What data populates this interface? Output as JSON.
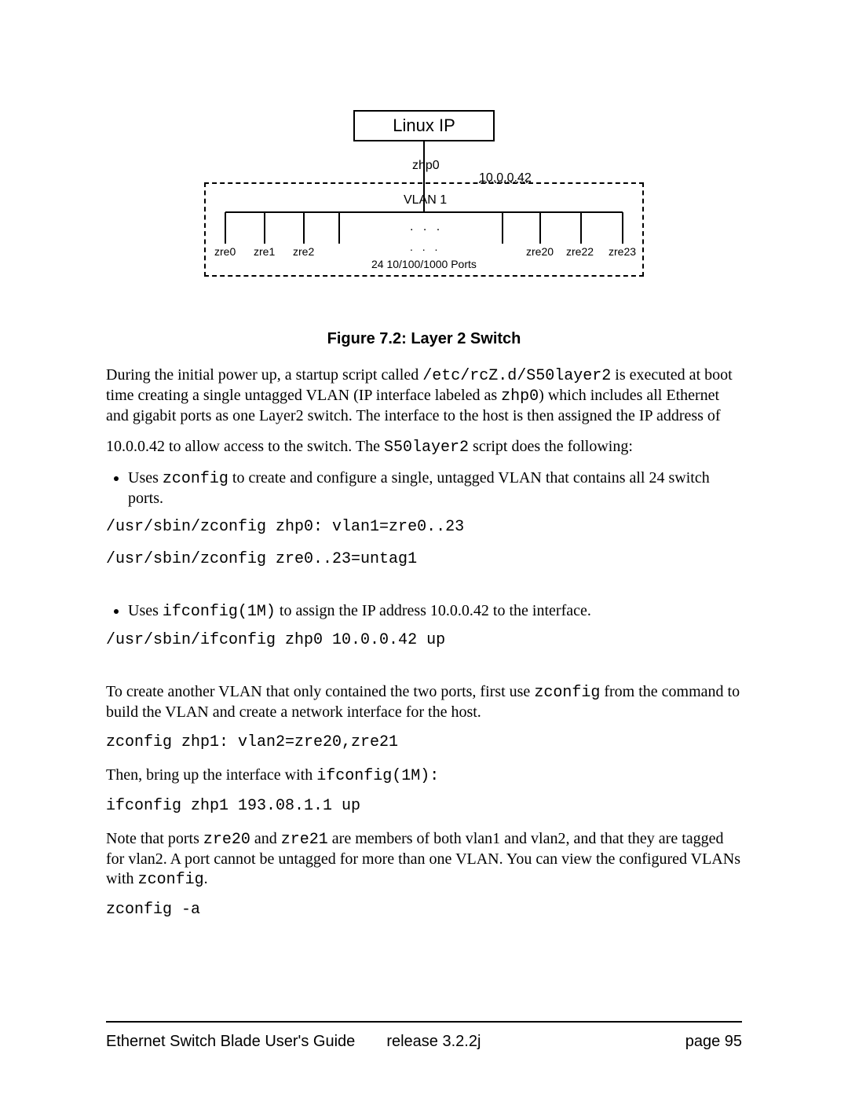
{
  "diagram": {
    "title": "Linux  IP",
    "zhp_label": "zhp0",
    "ip_label": "10.0.0.42",
    "vlan_label": "VLAN 1",
    "left_ports": [
      "zre0",
      "zre1",
      "zre2"
    ],
    "right_ports": [
      "zre20",
      "zre22",
      "zre23"
    ],
    "dots1": ". . .",
    "dots2": ". . .",
    "ports_note": "24 10/100/1000 Ports"
  },
  "figure_caption": "Figure 7.2: Layer 2 Switch",
  "para1_a": "During the initial power up, a startup script called ",
  "para1_code1": "/etc/rcZ.d/S50layer2",
  "para1_b": " is executed at boot time creating a single untagged VLAN (IP interface labeled as ",
  "para1_code2": "zhp0",
  "para1_c": ") which includes all Ethernet and gigabit ports as one Layer2 switch. The interface to the host is then assigned the IP address of",
  "para2_a": "10.0.0.42 to allow access to the switch. The ",
  "para2_code": "S50layer2",
  "para2_b": " script does the following:",
  "bullet1_a": "Uses ",
  "bullet1_code": "zconfig",
  "bullet1_b": " to create and configure a single, untagged VLAN that contains all 24 switch ports.",
  "cmd1": "/usr/sbin/zconfig zhp0: vlan1=zre0..23",
  "cmd2": "/usr/sbin/zconfig zre0..23=untag1",
  "bullet2_a": "Uses ",
  "bullet2_code": "ifconfig(1M)",
  "bullet2_b": " to assign the IP address 10.0.0.42 to the interface.",
  "cmd3": "/usr/sbin/ifconfig zhp0 10.0.0.42 up",
  "para3_a": "To create another VLAN that only contained the two ports, first use ",
  "para3_code": "zconfig",
  "para3_b": " from the command to build the VLAN and create a network interface for the host.",
  "cmd4": "zconfig zhp1: vlan2=zre20,zre21",
  "para4_a": "Then, bring up the interface with ",
  "para4_code": "ifconfig(1M):",
  "cmd5": "ifconfig zhp1 193.08.1.1 up",
  "para5_a": "Note that ports ",
  "para5_code1": "zre20",
  "para5_b": " and ",
  "para5_code2": "zre21",
  "para5_c": " are members of both vlan1 and vlan2, and that they are tagged for vlan2. A port cannot be untagged for more than one VLAN. You can view the configured VLANs with ",
  "para5_code3": "zconfig",
  "para5_d": ".",
  "cmd6": "zconfig -a",
  "footer": {
    "guide": "Ethernet Switch Blade User's Guide",
    "release": "release  3.2.2j",
    "page": "page 95"
  }
}
